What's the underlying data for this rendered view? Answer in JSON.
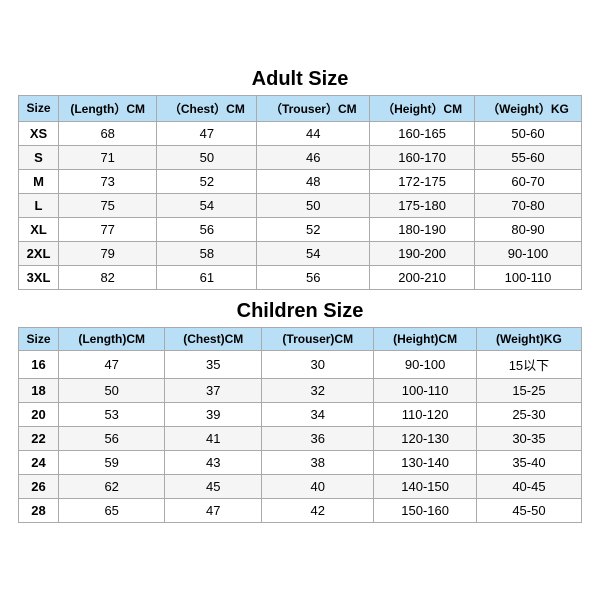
{
  "adult": {
    "title": "Adult Size",
    "headers": [
      "Size",
      "(Length）CM",
      "（Chest）CM",
      "（Trouser）CM",
      "（Height）CM",
      "（Weight）KG"
    ],
    "rows": [
      [
        "XS",
        "68",
        "47",
        "44",
        "160-165",
        "50-60"
      ],
      [
        "S",
        "71",
        "50",
        "46",
        "160-170",
        "55-60"
      ],
      [
        "M",
        "73",
        "52",
        "48",
        "172-175",
        "60-70"
      ],
      [
        "L",
        "75",
        "54",
        "50",
        "175-180",
        "70-80"
      ],
      [
        "XL",
        "77",
        "56",
        "52",
        "180-190",
        "80-90"
      ],
      [
        "2XL",
        "79",
        "58",
        "54",
        "190-200",
        "90-100"
      ],
      [
        "3XL",
        "82",
        "61",
        "56",
        "200-210",
        "100-110"
      ]
    ]
  },
  "children": {
    "title": "Children Size",
    "headers": [
      "Size",
      "(Length)CM",
      "(Chest)CM",
      "(Trouser)CM",
      "(Height)CM",
      "(Weight)KG"
    ],
    "rows": [
      [
        "16",
        "47",
        "35",
        "30",
        "90-100",
        "15以下"
      ],
      [
        "18",
        "50",
        "37",
        "32",
        "100-110",
        "15-25"
      ],
      [
        "20",
        "53",
        "39",
        "34",
        "110-120",
        "25-30"
      ],
      [
        "22",
        "56",
        "41",
        "36",
        "120-130",
        "30-35"
      ],
      [
        "24",
        "59",
        "43",
        "38",
        "130-140",
        "35-40"
      ],
      [
        "26",
        "62",
        "45",
        "40",
        "140-150",
        "40-45"
      ],
      [
        "28",
        "65",
        "47",
        "42",
        "150-160",
        "45-50"
      ]
    ]
  }
}
